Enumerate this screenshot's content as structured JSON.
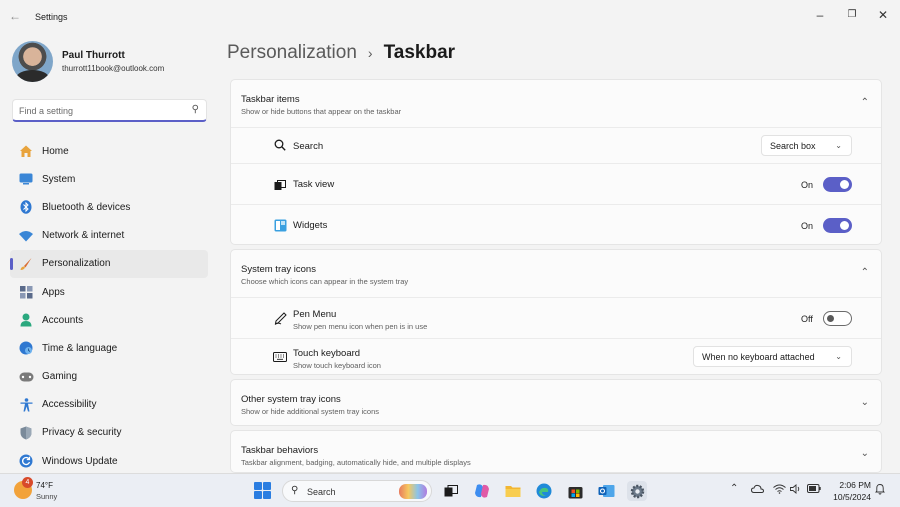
{
  "window": {
    "title": "Settings",
    "back_icon": "arrow-left-icon",
    "controls": [
      "minimize-icon",
      "restore-icon",
      "close-icon"
    ]
  },
  "account": {
    "name": "Paul Thurrott",
    "email": "thurrott11book@outlook.com"
  },
  "search": {
    "placeholder": "Find a setting",
    "icon": "search-icon"
  },
  "sidebar": {
    "items": [
      {
        "label": "Home",
        "icon": "home-icon",
        "color": "#e8a33c"
      },
      {
        "label": "System",
        "icon": "monitor-icon",
        "color": "#3a86d6"
      },
      {
        "label": "Bluetooth & devices",
        "icon": "bluetooth-icon",
        "color": "#2f78d1"
      },
      {
        "label": "Network & internet",
        "icon": "wifi-icon",
        "color": "#3a86d6"
      },
      {
        "label": "Personalization",
        "icon": "brush-icon",
        "color": "#e07b3c",
        "active": true
      },
      {
        "label": "Apps",
        "icon": "apps-icon",
        "color": "#5a6a8a"
      },
      {
        "label": "Accounts",
        "icon": "person-icon",
        "color": "#2aa87e"
      },
      {
        "label": "Time & language",
        "icon": "globe-clock-icon",
        "color": "#2f78d1"
      },
      {
        "label": "Gaming",
        "icon": "gamepad-icon",
        "color": "#7a7a7a"
      },
      {
        "label": "Accessibility",
        "icon": "accessibility-icon",
        "color": "#2f78d1"
      },
      {
        "label": "Privacy & security",
        "icon": "shield-icon",
        "color": "#7a8a9a"
      },
      {
        "label": "Windows Update",
        "icon": "refresh-icon",
        "color": "#2f78d1"
      }
    ]
  },
  "breadcrumb": {
    "parent": "Personalization",
    "separator": "›",
    "current": "Taskbar"
  },
  "sections": {
    "taskbar_items": {
      "title": "Taskbar items",
      "subtitle": "Show or hide buttons that appear on the taskbar",
      "expanded": true,
      "rows": {
        "search": {
          "label": "Search",
          "icon": "search-icon",
          "value": "Search box"
        },
        "task_view": {
          "label": "Task view",
          "icon": "task-view-icon",
          "state": "On",
          "on": true
        },
        "widgets": {
          "label": "Widgets",
          "icon": "widgets-icon",
          "state": "On",
          "on": true
        }
      }
    },
    "system_tray_icons": {
      "title": "System tray icons",
      "subtitle": "Choose which icons can appear in the system tray",
      "expanded": true,
      "rows": {
        "pen_menu": {
          "label": "Pen Menu",
          "sub": "Show pen menu icon when pen is in use",
          "icon": "pen-icon",
          "state": "Off",
          "on": false
        },
        "touch_keyboard": {
          "label": "Touch keyboard",
          "sub": "Show touch keyboard icon",
          "icon": "keyboard-icon",
          "value": "When no keyboard attached"
        }
      }
    },
    "other_tray_icons": {
      "title": "Other system tray icons",
      "subtitle": "Show or hide additional system tray icons",
      "expanded": false
    },
    "taskbar_behaviors": {
      "title": "Taskbar behaviors",
      "subtitle": "Taskbar alignment, badging, automatically hide, and multiple displays",
      "expanded": false
    }
  },
  "taskbar": {
    "weather": {
      "temp": "74°F",
      "condition": "Sunny",
      "badge": "4"
    },
    "search_label": "Search",
    "apps": [
      "task-view-icon",
      "copilot-icon",
      "file-explorer-icon",
      "edge-icon",
      "store-icon",
      "outlook-icon",
      "settings-icon"
    ],
    "tray": [
      "chevron-up-icon",
      "onedrive-icon",
      "wifi-icon",
      "volume-icon",
      "battery-icon"
    ],
    "time": "2:06 PM",
    "date": "10/5/2024"
  },
  "colors": {
    "accent": "#5b5fc7",
    "background": "#f3f3f3",
    "card": "#fbfbfb"
  }
}
